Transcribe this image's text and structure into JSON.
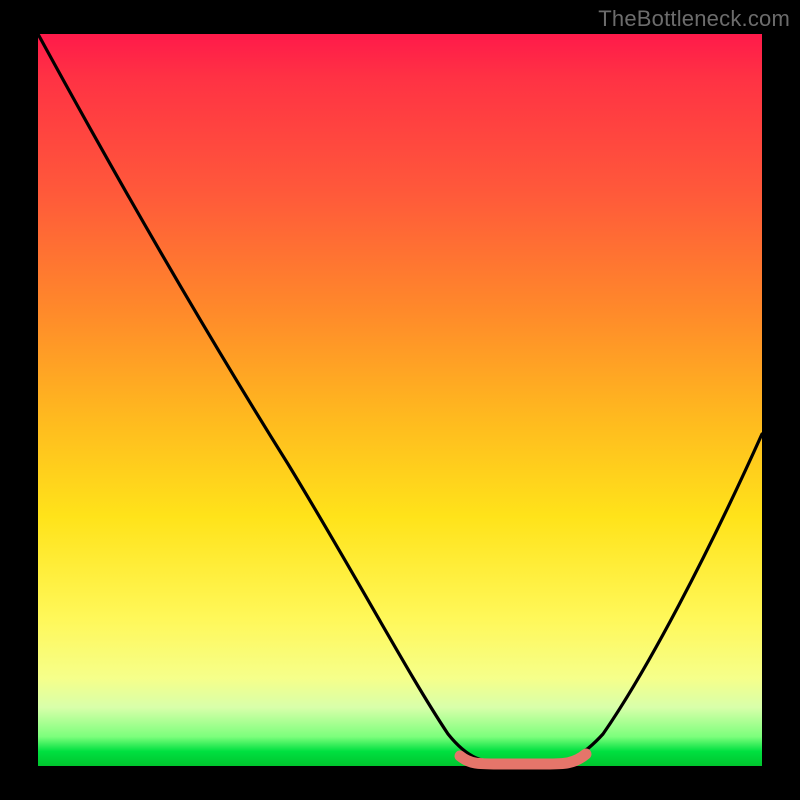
{
  "watermark": "TheBottleneck.com",
  "chart_data": {
    "type": "line",
    "title": "",
    "xlabel": "",
    "ylabel": "",
    "xlim": [
      0,
      100
    ],
    "ylim": [
      0,
      100
    ],
    "series": [
      {
        "name": "bottleneck-curve",
        "x": [
          0,
          10,
          20,
          30,
          40,
          50,
          56,
          60,
          64,
          68,
          72,
          80,
          90,
          100
        ],
        "values": [
          100,
          84,
          68,
          52,
          36,
          20,
          8,
          2,
          0,
          0,
          1,
          12,
          30,
          50
        ]
      }
    ],
    "optimal_zone": {
      "x_start": 58,
      "x_end": 72,
      "y": 1
    },
    "background_gradient": {
      "top": "#ff1a4a",
      "mid": "#ffe31a",
      "bottom": "#00c52e"
    }
  }
}
